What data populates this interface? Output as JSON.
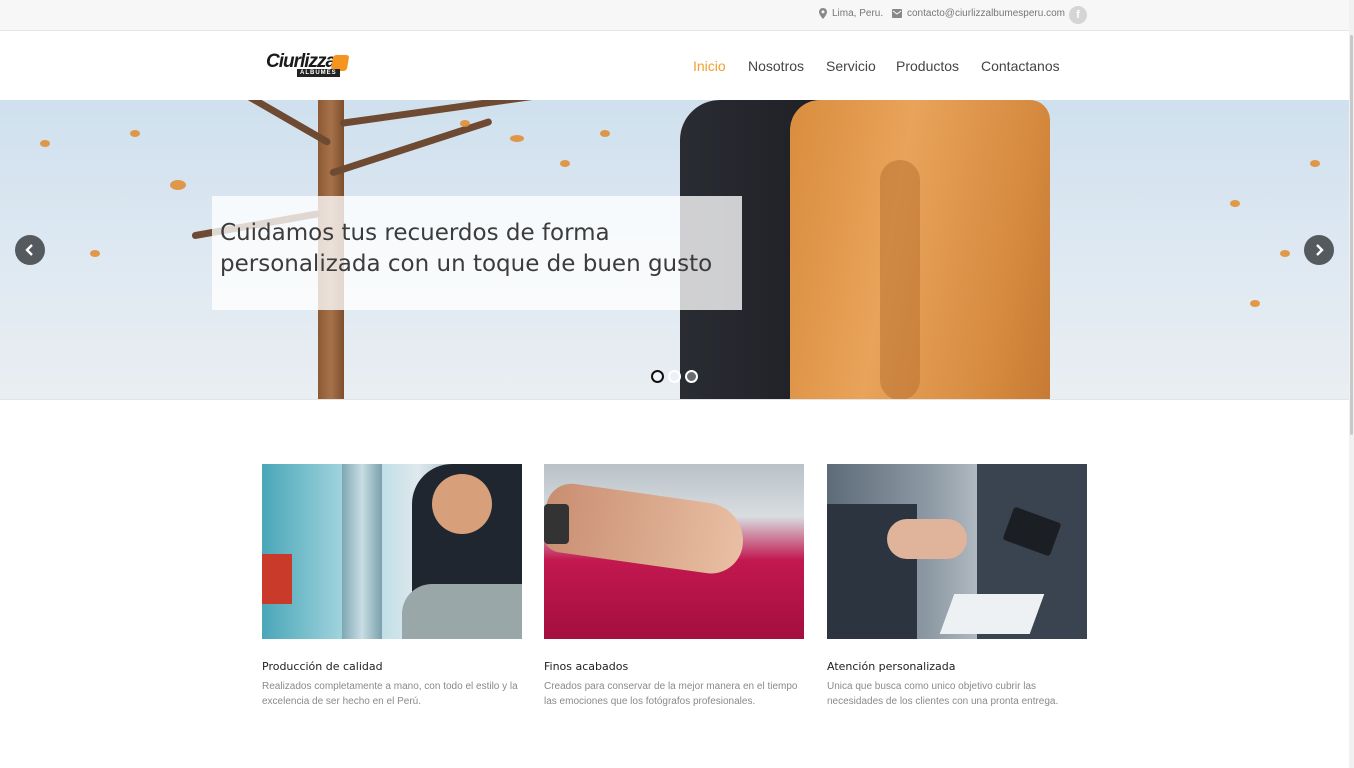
{
  "topbar": {
    "location": "Lima, Peru.",
    "email": "contacto@ciurlizzalbumesperu.com",
    "social_icon": "facebook-icon"
  },
  "header": {
    "logo_text": "Ciurlizza",
    "logo_sub": "ALBUMES",
    "nav": [
      "Inicio",
      "Nosotros",
      "Servicio",
      "Productos",
      "Contactanos"
    ],
    "active_color": "#f0a030"
  },
  "hero": {
    "caption_line1": "Cuidamos tus recuerdos de forma",
    "caption_line2": "personalizada con un toque de buen gusto",
    "prev_icon": "chevron-left-icon",
    "next_icon": "chevron-right-icon",
    "slides_total": 3,
    "active_slide": 1
  },
  "features": [
    {
      "title": "Producción de calidad",
      "text": "Realizados completamente a mano, con todo el estilo y la excelencia de ser hecho en el Perú."
    },
    {
      "title": "Finos acabados",
      "text": "Creados para conservar de la mejor manera en el tiempo las emociones que los fotógrafos profesionales."
    },
    {
      "title": "Atención personalizada",
      "text": "Unica que busca como unico objetivo cubrir las necesidades de los clientes con una pronta entrega."
    }
  ]
}
